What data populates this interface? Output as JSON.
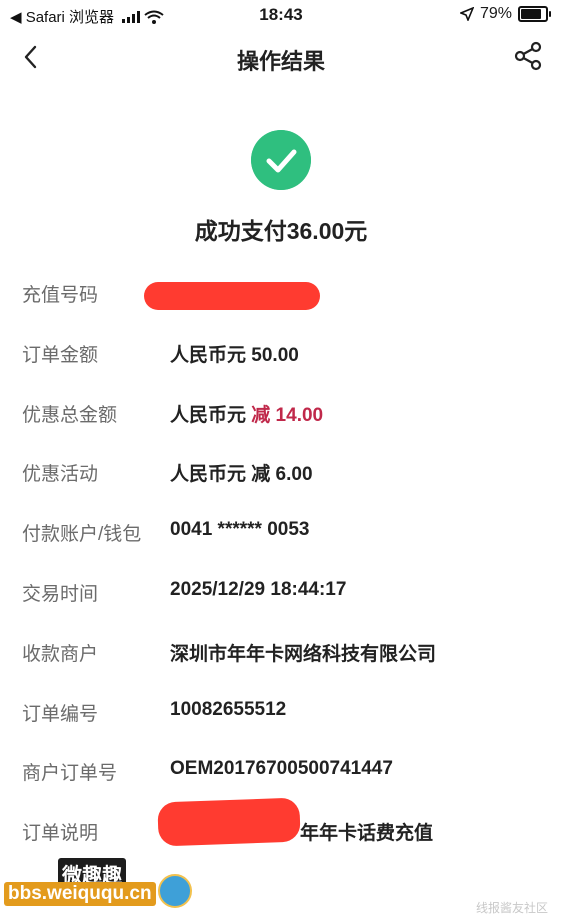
{
  "status_bar": {
    "carrier": "◀ Safari 浏览器",
    "time": "18:43",
    "battery": "79%"
  },
  "nav": {
    "title": "操作结果"
  },
  "success": {
    "text": "成功支付36.00元"
  },
  "details": [
    {
      "label": "充值号码",
      "value": ""
    },
    {
      "label": "订单金额",
      "value": "人民币元 50.00"
    },
    {
      "label": "优惠总金额",
      "value_prefix": "人民币元 ",
      "value_highlight": "减 14.00"
    },
    {
      "label": "优惠活动",
      "value": "人民币元 减 6.00"
    },
    {
      "label": "付款账户/钱包",
      "value": "0041 ****** 0053"
    },
    {
      "label": "交易时间",
      "value": "2025/12/29 18:44:17"
    },
    {
      "label": "收款商户",
      "value": "深圳市年年卡网络科技有限公司"
    },
    {
      "label": "订单编号",
      "value": "10082655512"
    },
    {
      "label": "商户订单号",
      "value": "OEM20176700500741447"
    },
    {
      "label": "订单说明",
      "value": "年年卡话费充值"
    }
  ],
  "colors": {
    "success_green": "#2fbf7f",
    "discount_red": "#c0284a"
  },
  "watermark": {
    "top": "微趣趣",
    "bottom": "bbs.weiququ.cn",
    "corner": "线报酱友社区"
  }
}
